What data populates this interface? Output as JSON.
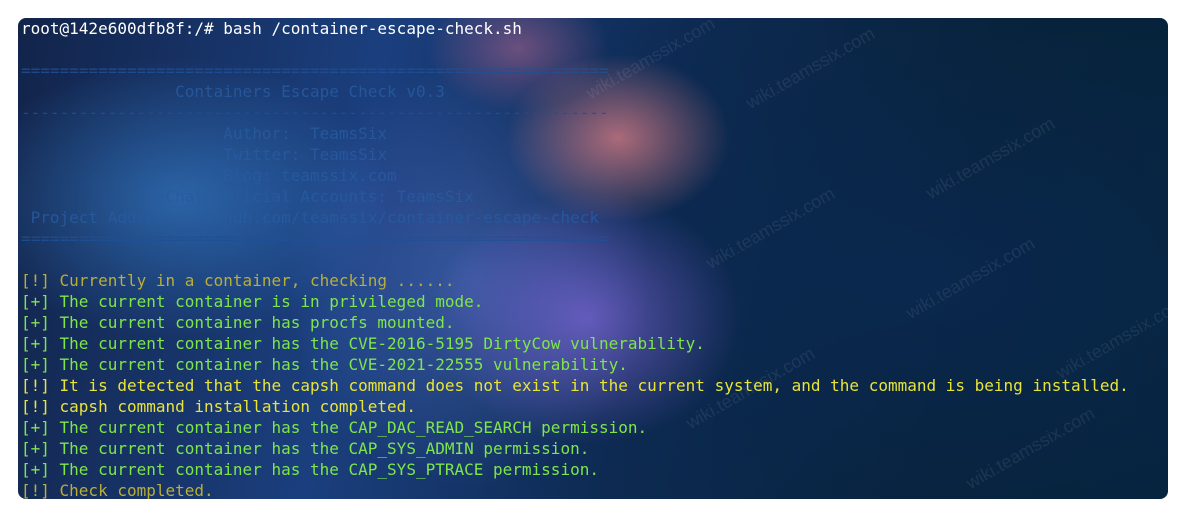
{
  "terminal": {
    "prompt": "root@142e600dfb8f:/# bash /container-escape-check.sh",
    "blank1": " ",
    "separator1": "=============================================================",
    "banner_title": "                Containers Escape Check v0.3",
    "separator2": "-------------------------------------------------------------",
    "author": "                     Author:  TeamsSix",
    "twitter": "                     Twitter: TeamsSix",
    "blog": "                     Blog: teamssix.com",
    "wechat": "             WeChat Official Accounts: TeamsSix",
    "project": " Project Address: github.com/teamssix/container-escape-check",
    "separator3": "=============================================================",
    "blank2": " ",
    "out1": "[!] Currently in a container, checking ......",
    "out2": "[+] The current container is in privileged mode.",
    "out3": "[+] The current container has procfs mounted.",
    "out4": "[+] The current container has the CVE-2016-5195 DirtyCow vulnerability.",
    "out5": "[+] The current container has the CVE-2021-22555 vulnerability.",
    "out6": "[!] It is detected that the capsh command does not exist in the current system, and the command is being installed.",
    "out7": "[!] capsh command installation completed.",
    "out8": "[+] The current container has the CAP_DAC_READ_SEARCH permission.",
    "out9": "[+] The current container has the CAP_SYS_ADMIN permission.",
    "out10": "[+] The current container has the CAP_SYS_PTRACE permission.",
    "out11": "[!] Check completed."
  },
  "watermark": "wiki.teamssix.com",
  "colors": {
    "green": "#7ee64a",
    "yellow": "#e8e43a",
    "prompt": "#ffffff"
  }
}
